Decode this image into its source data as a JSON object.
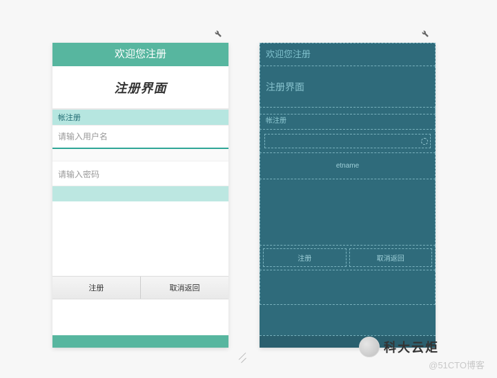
{
  "left": {
    "titlebar": "欢迎您注册",
    "header": "注册界面",
    "label": "帐注册",
    "username_placeholder": "请输入用户名",
    "password_placeholder": "请输入密码",
    "buttons": {
      "register": "注册",
      "cancel": "取消返回"
    }
  },
  "right": {
    "titlebar": "欢迎您注册",
    "header": "注册界面",
    "label": "帐注册",
    "etname": "etname",
    "buttons": {
      "register": "注册",
      "cancel": "取消返回"
    }
  },
  "watermark": {
    "main": "科大云炬",
    "sub": "@51CTO博客"
  }
}
